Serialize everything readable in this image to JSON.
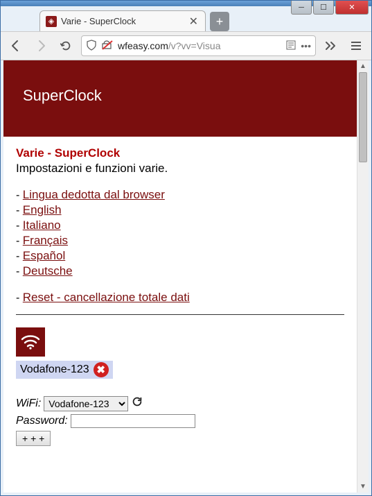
{
  "window": {
    "tab_title": "Varie - SuperClock",
    "url_host": "wfeasy.com",
    "url_rest": "/v?vv=Visua"
  },
  "banner": {
    "brand": "SuperClock"
  },
  "page": {
    "heading": "Varie - SuperClock",
    "subtitle": "Impostazioni e funzioni varie.",
    "links": [
      "Lingua dedotta dal browser",
      "English",
      "Italiano",
      "Français",
      "Español",
      "Deutsche"
    ],
    "reset_link": "Reset - cancellazione totale dati"
  },
  "wifi": {
    "current_name": "Vodafone-123",
    "label_wifi": "WiFi:",
    "label_password": "Password:",
    "select_value": "Vodafone-123",
    "password_value": "",
    "add_button": "+ + +"
  }
}
